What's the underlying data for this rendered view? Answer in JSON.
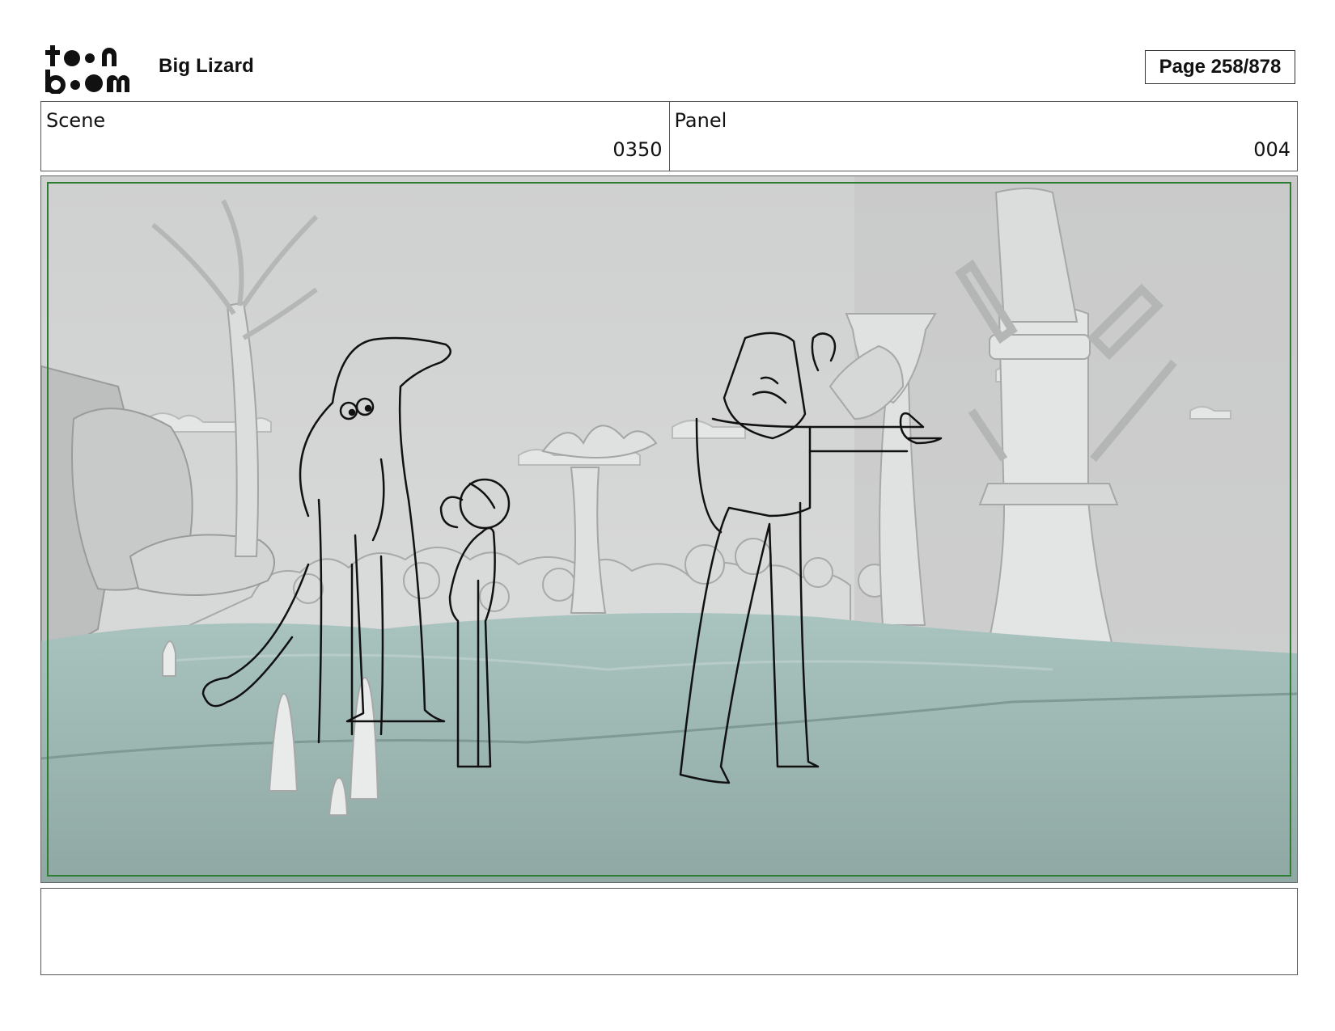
{
  "header": {
    "logo_name": "toon-boom-logo",
    "project_title": "Big Lizard",
    "page_label": "Page 258/878"
  },
  "info": {
    "scene_label": "Scene",
    "scene_value": "0350",
    "panel_label": "Panel",
    "panel_value": "004"
  },
  "panel_image": {
    "frame_color": "#2e7d32",
    "characters": [
      "lizard",
      "girl",
      "tall-man-pointing"
    ]
  },
  "caption": {
    "text": ""
  }
}
